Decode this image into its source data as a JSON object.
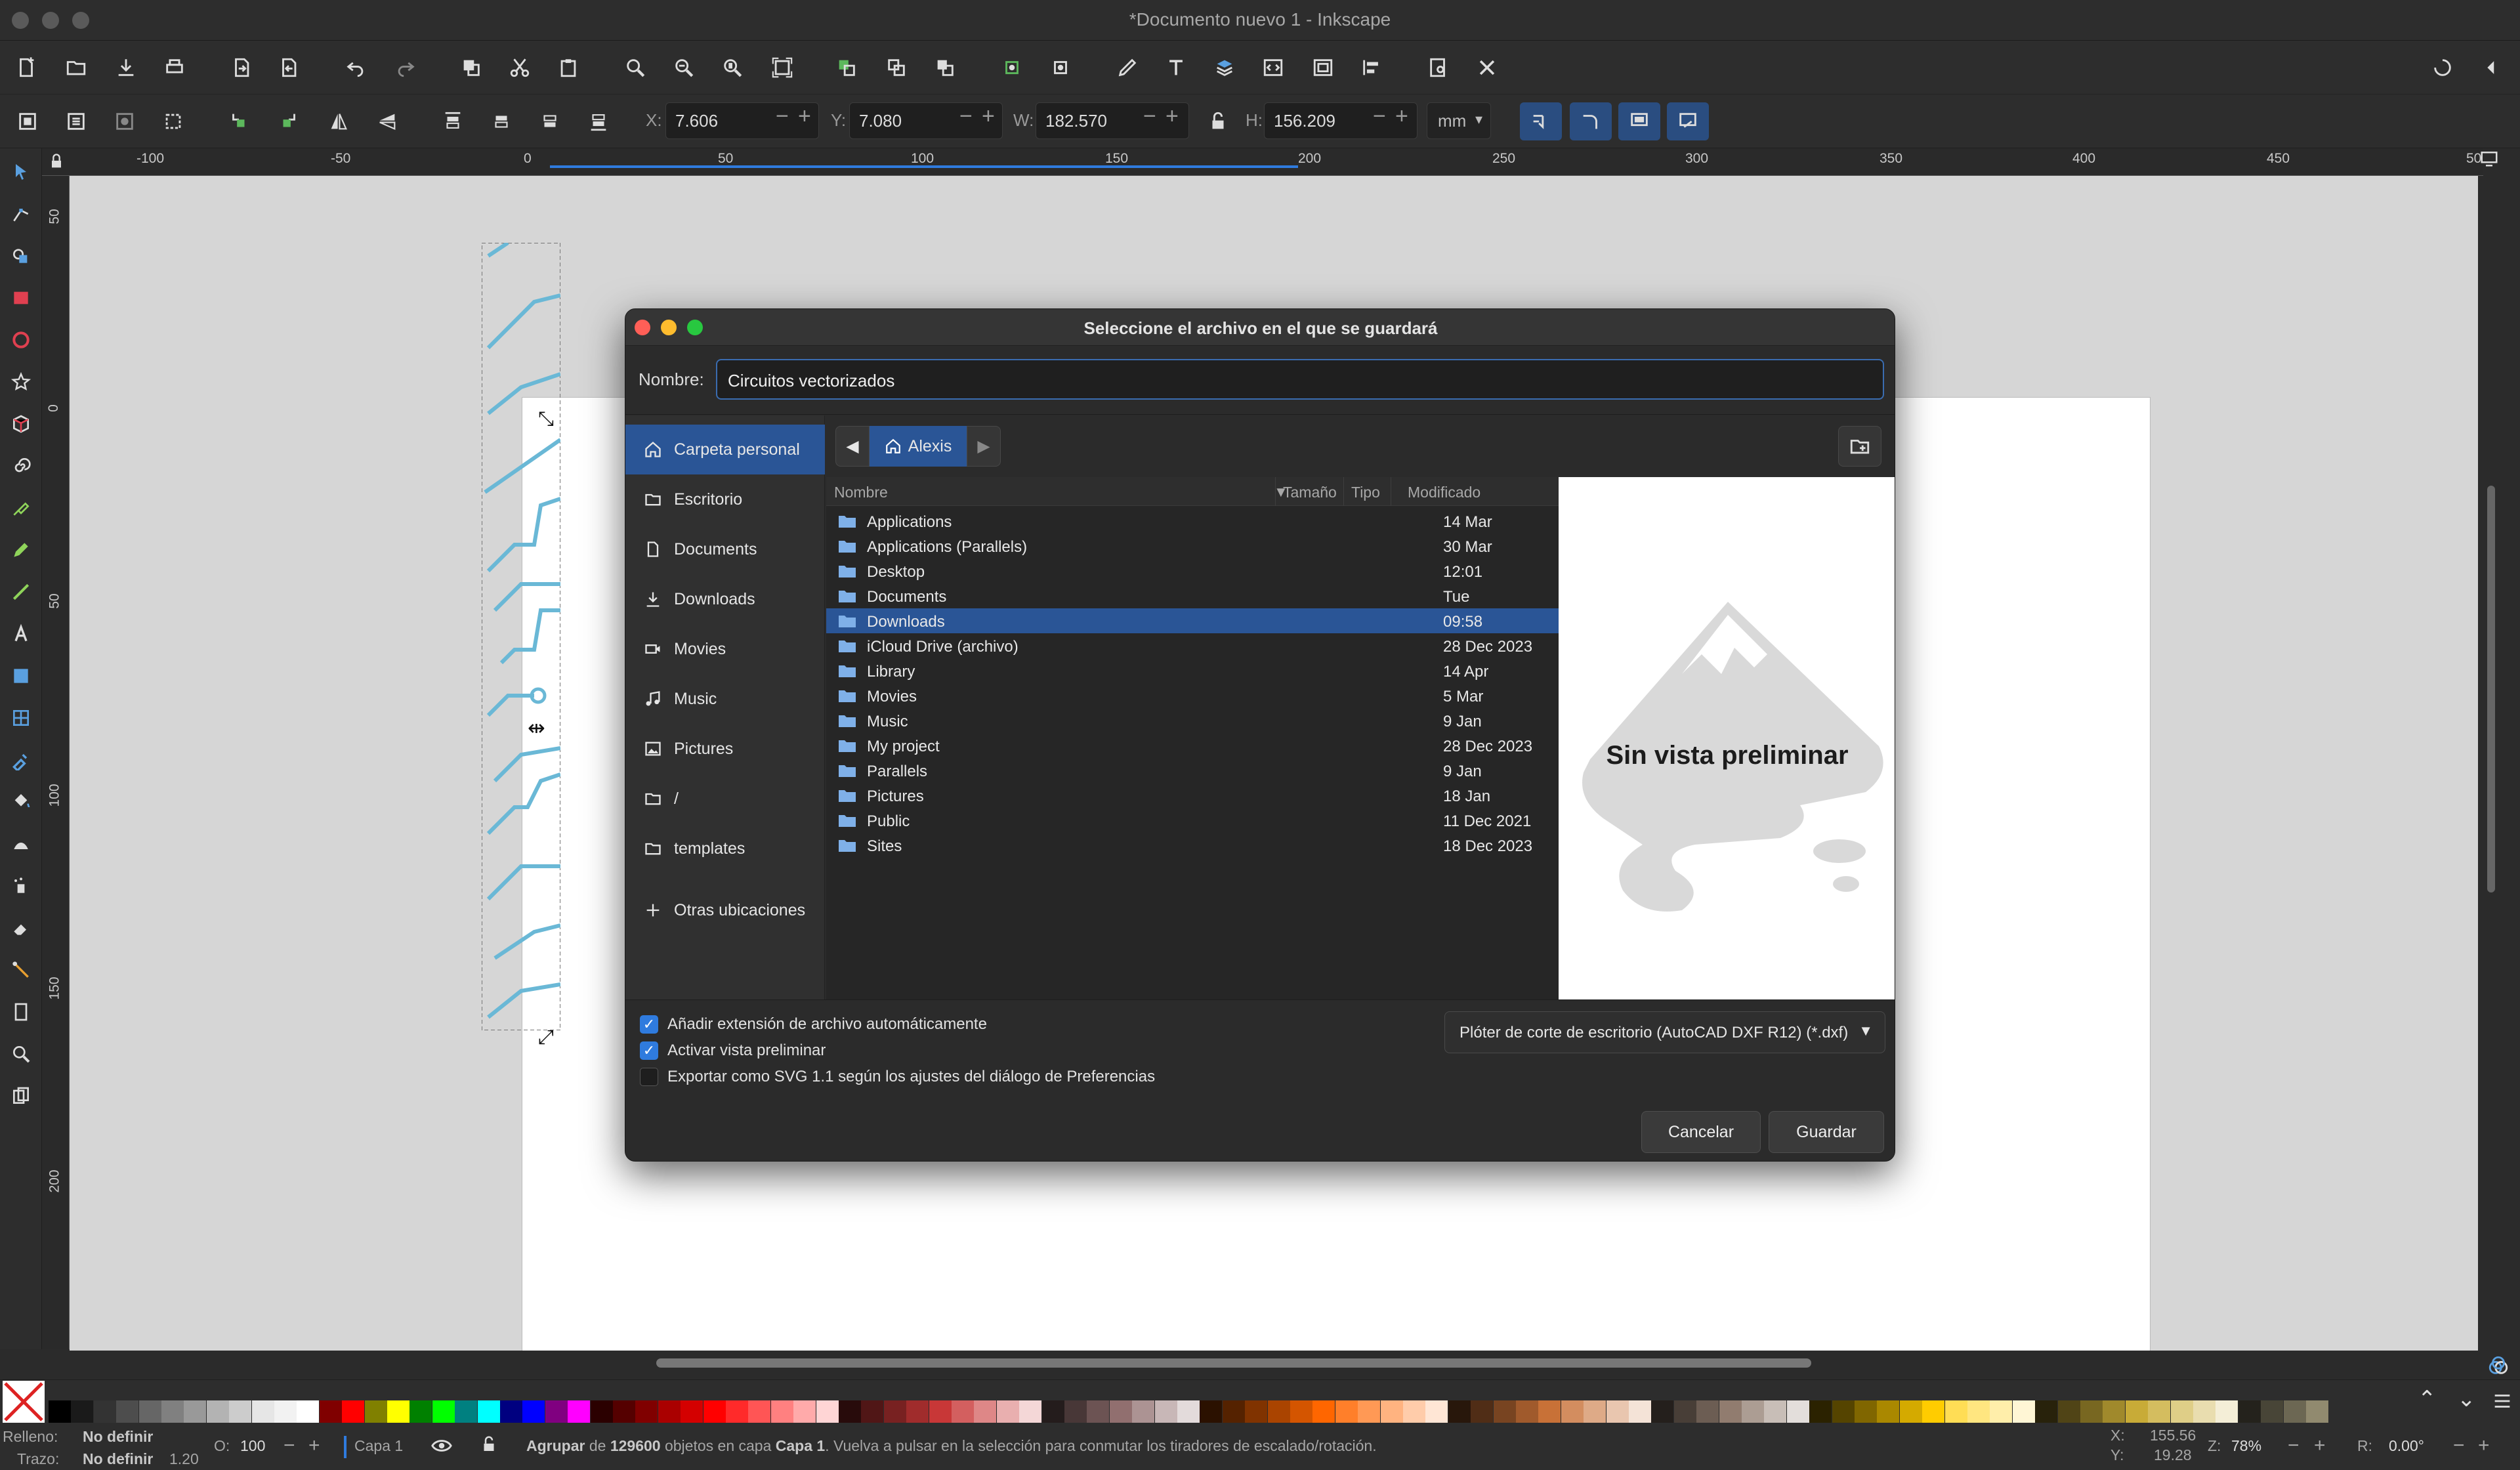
{
  "window": {
    "title": "*Documento nuevo 1 - Inkscape"
  },
  "controls": {
    "x_label": "X:",
    "x_value": "7.606",
    "y_label": "Y:",
    "y_value": "7.080",
    "w_label": "W:",
    "w_value": "182.570",
    "h_label": "H:",
    "h_value": "156.209",
    "unit": "mm",
    "minus": "−",
    "plus": "+"
  },
  "ruler": {
    "h_labels": [
      "-100",
      "-50",
      "0",
      "50",
      "100",
      "150",
      "200",
      "250",
      "300",
      "350",
      "400",
      "450",
      "50"
    ],
    "v_labels": [
      "50",
      "0",
      "50",
      "100",
      "150",
      "200"
    ]
  },
  "dialog": {
    "title": "Seleccione el archivo en el que se guardará",
    "name_label": "Nombre:",
    "name_value": "Circuitos vectorizados",
    "places": [
      {
        "label": "Carpeta personal",
        "icon": "home-icon"
      },
      {
        "label": "Escritorio",
        "icon": "folder-icon"
      },
      {
        "label": "Documents",
        "icon": "document-icon"
      },
      {
        "label": "Downloads",
        "icon": "download-icon"
      },
      {
        "label": "Movies",
        "icon": "camera-icon"
      },
      {
        "label": "Music",
        "icon": "music-icon"
      },
      {
        "label": "Pictures",
        "icon": "image-icon"
      },
      {
        "label": "/",
        "icon": "folder-icon"
      },
      {
        "label": "templates",
        "icon": "folder-icon"
      },
      {
        "label": "Otras ubicaciones",
        "icon": "plus-icon"
      }
    ],
    "path_current": "Alexis",
    "columns": {
      "name": "Nombre",
      "size": "Tamaño",
      "type": "Tipo",
      "modified": "Modificado"
    },
    "files": [
      {
        "name": "Applications",
        "modified": "14 Mar"
      },
      {
        "name": "Applications (Parallels)",
        "modified": "30 Mar"
      },
      {
        "name": "Desktop",
        "modified": "12:01"
      },
      {
        "name": "Documents",
        "modified": "Tue"
      },
      {
        "name": "Downloads",
        "modified": "09:58"
      },
      {
        "name": "iCloud Drive (archivo)",
        "modified": "28 Dec 2023"
      },
      {
        "name": "Library",
        "modified": "14 Apr"
      },
      {
        "name": "Movies",
        "modified": "5 Mar"
      },
      {
        "name": "Music",
        "modified": "9 Jan"
      },
      {
        "name": "My project",
        "modified": "28 Dec 2023"
      },
      {
        "name": "Parallels",
        "modified": "9 Jan"
      },
      {
        "name": "Pictures",
        "modified": "18 Jan"
      },
      {
        "name": "Public",
        "modified": "11 Dec 2021"
      },
      {
        "name": "Sites",
        "modified": "18 Dec 2023"
      }
    ],
    "preview_text": "Sin vista preliminar",
    "options": [
      {
        "label": "Añadir extensión de archivo automáticamente",
        "checked": true
      },
      {
        "label": "Activar vista preliminar",
        "checked": true
      },
      {
        "label": "Exportar como SVG 1.1 según los ajustes del diálogo de Preferencias",
        "checked": false
      }
    ],
    "filetype": "Plóter de corte de escritorio (AutoCAD DXF R12) (*.dxf)",
    "cancel_label": "Cancelar",
    "save_label": "Guardar"
  },
  "status": {
    "fill_label": "Relleno:",
    "fill_value": "No definir",
    "stroke_label": "Trazo:",
    "stroke_value": "No definir",
    "stroke_width": "1.20",
    "opacity_label": "O:",
    "opacity_value": "100",
    "layer": "Capa 1",
    "message_pre": "Agrupar",
    "message_de": "de",
    "message_count": "129600",
    "message_mid": "objetos en capa",
    "message_layer": "Capa 1",
    "message_post": ". Vuelva a pulsar en la selección para conmutar los tiradores de escalado/rotación.",
    "cursor_x_label": "X:",
    "cursor_x": "155.56",
    "cursor_y_label": "Y:",
    "cursor_y": "19.28",
    "zoom_label": "Z:",
    "zoom": "78%",
    "rotation_label": "R:",
    "rotation": "0.00°"
  },
  "colors": {
    "accent": "#2a5596",
    "check": "#2f7bde",
    "palette": [
      "#000000",
      "#1a1a1a",
      "#333333",
      "#4d4d4d",
      "#666666",
      "#808080",
      "#999999",
      "#b3b3b3",
      "#cccccc",
      "#e6e6e6",
      "#f2f2f2",
      "#ffffff",
      "#800000",
      "#ff0000",
      "#808000",
      "#ffff00",
      "#008000",
      "#00ff00",
      "#008080",
      "#00ffff",
      "#000080",
      "#0000ff",
      "#800080",
      "#ff00ff",
      "#2b0000",
      "#550000",
      "#800000",
      "#aa0000",
      "#d40000",
      "#ff0000",
      "#ff2a2a",
      "#ff5555",
      "#ff8080",
      "#ffaaaa",
      "#ffd5d5",
      "#280b0b",
      "#501616",
      "#782121",
      "#a02c2c",
      "#c83737",
      "#d35f5f",
      "#de8787",
      "#e9afaf",
      "#f4d7d7",
      "#241c1c",
      "#483737",
      "#6c5353",
      "#916f6f",
      "#ac9393",
      "#c8b7b7",
      "#e3dbdb",
      "#2b1100",
      "#552200",
      "#803300",
      "#aa4400",
      "#d45500",
      "#ff6600",
      "#ff7f2a",
      "#ff9955",
      "#ffb380",
      "#ffccaa",
      "#ffe6d5",
      "#28170b",
      "#502d16",
      "#784421",
      "#a05a2c",
      "#c87137",
      "#d38d5f",
      "#deaa87",
      "#e9c6af",
      "#f4e3d7",
      "#241f1c",
      "#483e37",
      "#6c5d53",
      "#917c6f",
      "#ac9d93",
      "#c8beb7",
      "#e3dedb",
      "#2b2200",
      "#554400",
      "#806600",
      "#aa8800",
      "#d4aa00",
      "#ffcc00",
      "#ffdd55",
      "#ffe680",
      "#ffeeaa",
      "#fff6d5",
      "#28220b",
      "#504416",
      "#786721",
      "#a0892c",
      "#c8ab37",
      "#d4bd5f",
      "#dfce87",
      "#e9ddaf",
      "#f4eed7",
      "#24221c",
      "#484537",
      "#6c6753",
      "#918a6f"
    ]
  }
}
